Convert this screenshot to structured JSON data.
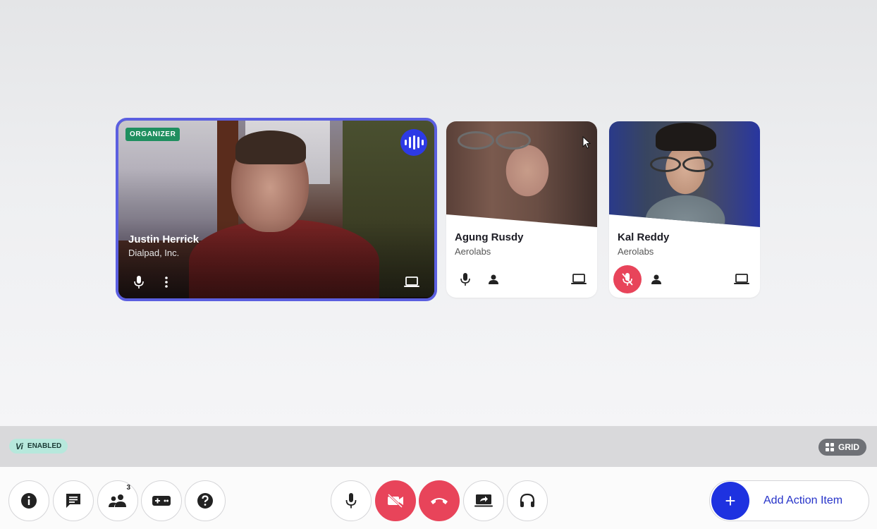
{
  "participants": {
    "main": {
      "badge": "ORGANIZER",
      "name": "Justin Herrick",
      "org": "Dialpad, Inc."
    },
    "tiles": [
      {
        "name": "Agung Rusdy",
        "org": "Aerolabs",
        "muted": false
      },
      {
        "name": "Kal Reddy",
        "org": "Aerolabs",
        "muted": true
      }
    ]
  },
  "status": {
    "vi_mark": "Vi",
    "vi_label": "ENABLED",
    "grid_label": "GRID"
  },
  "toolbar": {
    "participants_count": "3",
    "add_action_label": "Add Action Item"
  },
  "colors": {
    "active_border": "#5b5fe0",
    "speaking_indicator": "#2d3ae6",
    "organizer_badge": "#1f8f5f",
    "danger": "#e8445a",
    "primary": "#1e32e0"
  }
}
